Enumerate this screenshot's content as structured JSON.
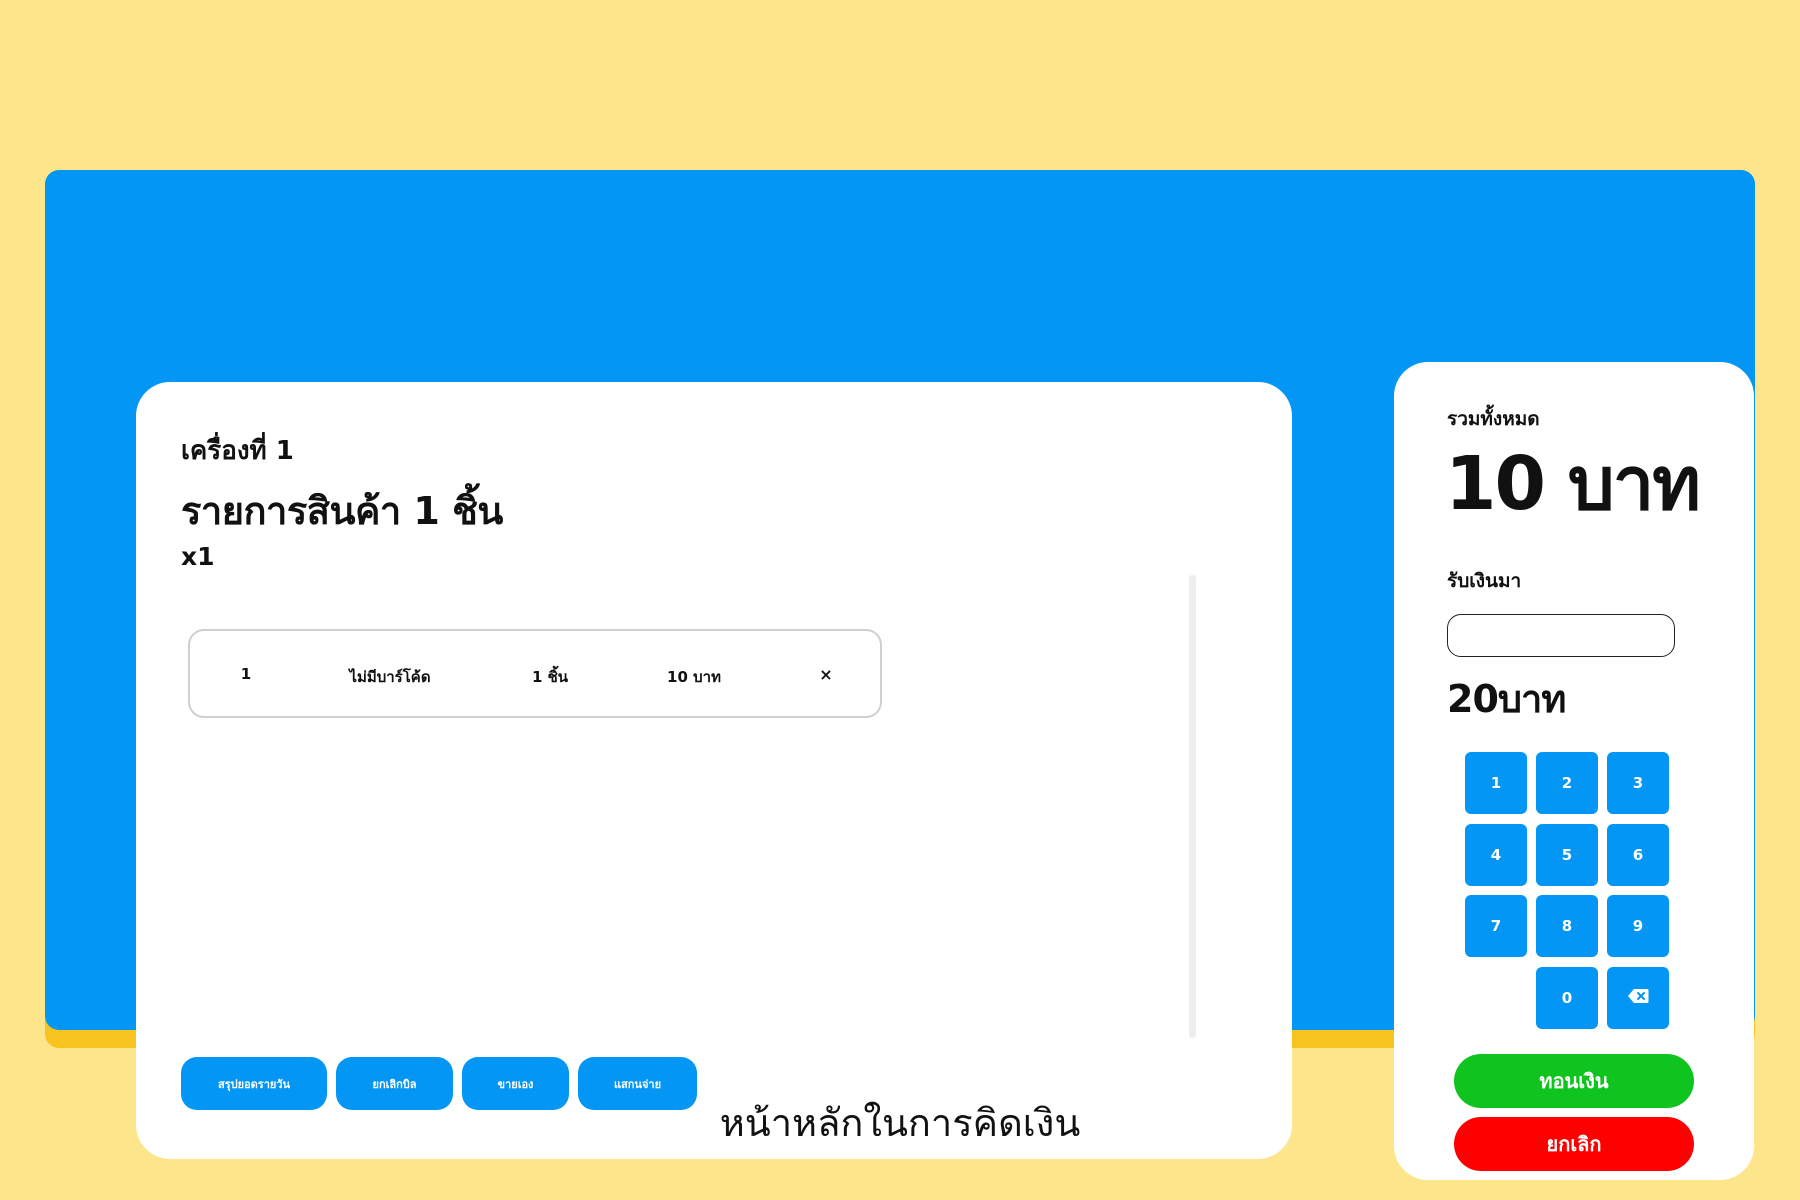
{
  "pos": {
    "terminal_label": "เครื่องที่ 1",
    "items_title": "รายการสินค้า 1 ชิ้น",
    "quantity_label": "x1",
    "items": [
      {
        "index": "1",
        "barcode": "ไม่มีบาร์โค้ด",
        "quantity": "1 ชิ้น",
        "price": "10 บาท",
        "remove": "×"
      }
    ],
    "actions": {
      "daily_summary": "สรุปยอดรายวัน",
      "cancel_bill": "ยกเลิกบิล",
      "manual_sale": "ขายเอง",
      "scan_pay": "แสกนจ่าย"
    }
  },
  "checkout": {
    "total_label": "รวมทั้งหมด",
    "total_amount": "10 บาท",
    "received_label": "รับเงินมา",
    "received_value": "",
    "change_amount": "20บาท",
    "keypad": {
      "k1": "1",
      "k2": "2",
      "k3": "3",
      "k4": "4",
      "k5": "5",
      "k6": "6",
      "k7": "7",
      "k8": "8",
      "k9": "9",
      "k0": "0"
    },
    "pay_button": "ทอนเงิน",
    "cancel_button": "ยกเลิก"
  },
  "caption": "หน้าหลักในการคิดเงิน",
  "colors": {
    "background": "#fde58c",
    "frame": "#0496f4",
    "frame_shadow": "#f7c31f",
    "pay": "#10c41f",
    "cancel": "#ff0000"
  },
  "icons": {
    "remove": "close-icon",
    "backspace": "backspace-icon"
  }
}
